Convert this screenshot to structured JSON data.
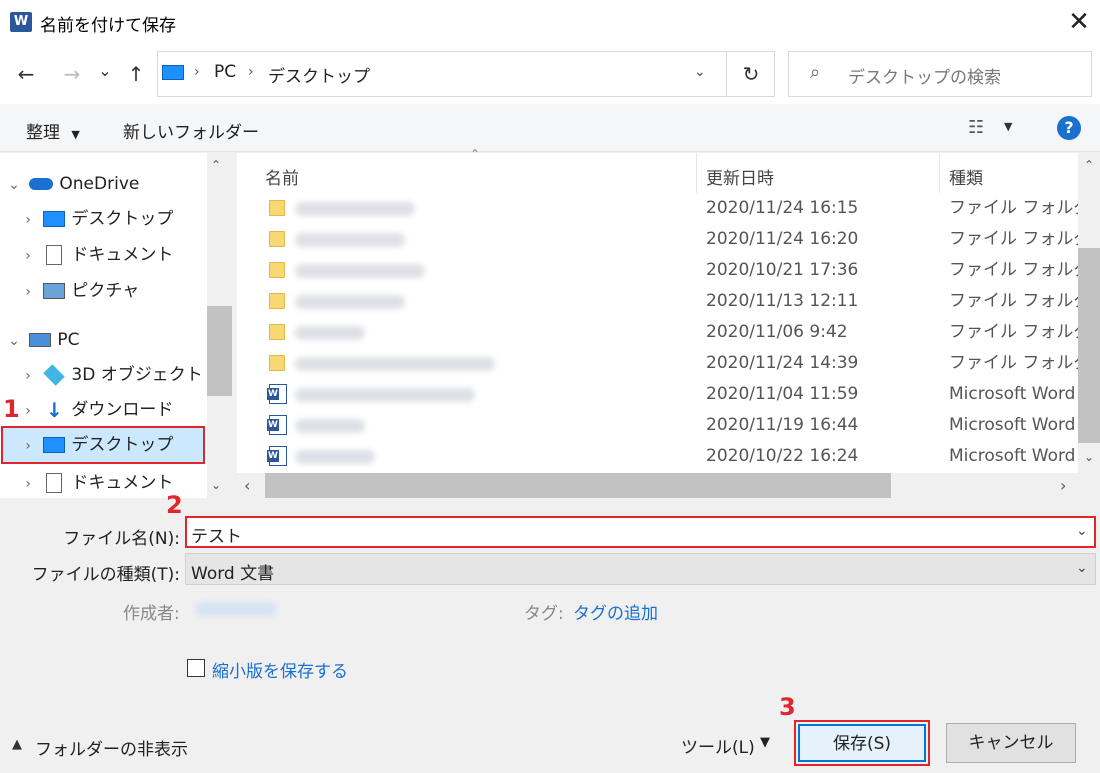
{
  "window": {
    "title": "名前を付けて保存",
    "app_icon": "W"
  },
  "nav": {
    "back": "←",
    "forward": "→",
    "recent": "⌄",
    "up": "↑",
    "breadcrumb": [
      "PC",
      "デスクトップ"
    ],
    "refresh": "↻",
    "search_placeholder": "デスクトップの検索"
  },
  "toolbar": {
    "organize": "整理",
    "new_folder": "新しいフォルダー",
    "help": "?"
  },
  "sidebar": {
    "items": [
      {
        "label": "OneDrive",
        "icon": "cloud-icon"
      },
      {
        "label": "デスクトップ",
        "icon": "desktop-icon"
      },
      {
        "label": "ドキュメント",
        "icon": "document-icon"
      },
      {
        "label": "ピクチャ",
        "icon": "picture-icon"
      },
      {
        "label": "PC",
        "icon": "computer-icon"
      },
      {
        "label": "3D オブジェクト",
        "icon": "cube-icon"
      },
      {
        "label": "ダウンロード",
        "icon": "download-icon"
      },
      {
        "label": "デスクトップ",
        "icon": "desktop-icon"
      },
      {
        "label": "ドキュメント",
        "icon": "document-icon"
      }
    ]
  },
  "filelist": {
    "columns": {
      "name": "名前",
      "date": "更新日時",
      "type": "種類"
    },
    "rows": [
      {
        "date": "2020/11/24 16:15",
        "type": "ファイル フォルダー",
        "icon": "folder-icon"
      },
      {
        "date": "2020/11/24 16:20",
        "type": "ファイル フォルダー",
        "icon": "folder-icon"
      },
      {
        "date": "2020/10/21 17:36",
        "type": "ファイル フォルダー",
        "icon": "folder-icon"
      },
      {
        "date": "2020/11/13 12:11",
        "type": "ファイル フォルダー",
        "icon": "folder-icon"
      },
      {
        "date": "2020/11/06 9:42",
        "type": "ファイル フォルダー",
        "icon": "folder-icon"
      },
      {
        "date": "2020/11/24 14:39",
        "type": "ファイル フォルダー",
        "icon": "folder-icon"
      },
      {
        "date": "2020/11/04 11:59",
        "type": "Microsoft Word",
        "icon": "word-file-icon"
      },
      {
        "date": "2020/11/19 16:44",
        "type": "Microsoft Word",
        "icon": "word-file-icon"
      },
      {
        "date": "2020/10/22 16:24",
        "type": "Microsoft Word",
        "icon": "word-file-icon"
      }
    ]
  },
  "form": {
    "filename_label": "ファイル名(N):",
    "filename_value": "テスト",
    "filetype_label": "ファイルの種類(T):",
    "filetype_value": "Word 文書",
    "author_label": "作成者:",
    "tags_label": "タグ:",
    "tags_link": "タグの追加",
    "thumbnail_label": "縮小版を保存する"
  },
  "footer": {
    "hide_folders": "フォルダーの非表示",
    "tools": "ツール(L)",
    "save": "保存(S)",
    "cancel": "キャンセル"
  },
  "annotations": [
    "1",
    "2",
    "3"
  ],
  "colors": {
    "highlight": "#e0252c",
    "accent": "#0078d7",
    "selection": "#cce8ff"
  }
}
